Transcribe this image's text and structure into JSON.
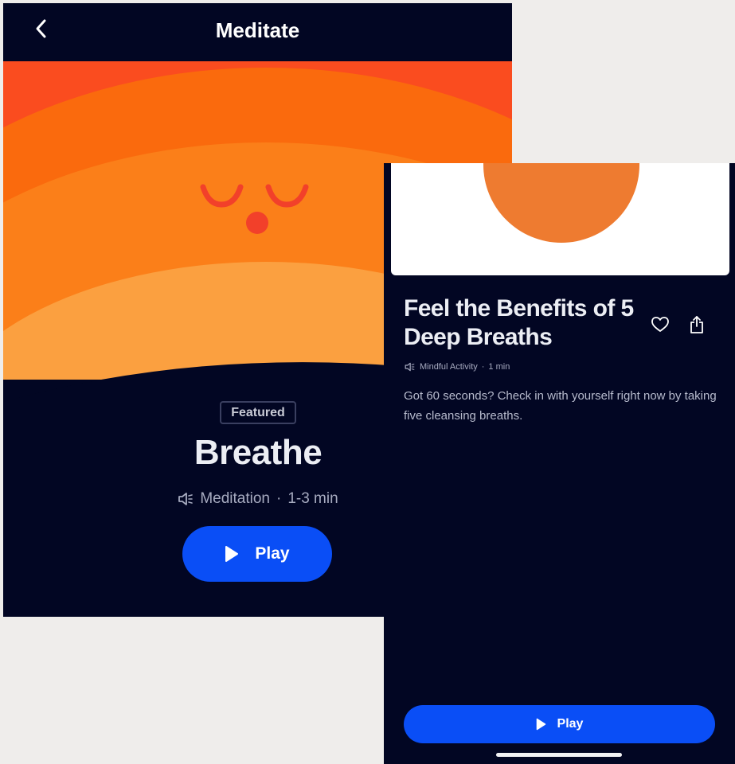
{
  "left_screen": {
    "header": {
      "title": "Meditate",
      "back_icon": "chevron-left-icon"
    },
    "badge": "Featured",
    "title": "Breathe",
    "meta": {
      "icon": "speaker-icon",
      "category": "Meditation",
      "separator": "·",
      "duration": "1-3 min"
    },
    "play_button": {
      "label": "Play",
      "icon": "play-icon"
    }
  },
  "right_screen": {
    "title": "Feel the Benefits of 5 Deep Breaths",
    "actions": {
      "favorite_icon": "heart-icon",
      "share_icon": "share-icon"
    },
    "meta": {
      "icon": "speaker-icon",
      "category": "Mindful Activity",
      "separator": "·",
      "duration": "1 min"
    },
    "description": "Got 60 seconds? Check in with yourself right now by taking five cleansing breaths.",
    "play_button": {
      "label": "Play",
      "icon": "play-icon"
    }
  },
  "colors": {
    "background": "#efedeb",
    "screen_bg": "#020623",
    "accent_blue": "#0a4ef6",
    "orange_1": "#fa4c1f",
    "orange_2": "#fa6a0d",
    "orange_3": "#fb7f19",
    "orange_4": "#fba040",
    "sun_orange": "#ee7b30"
  }
}
